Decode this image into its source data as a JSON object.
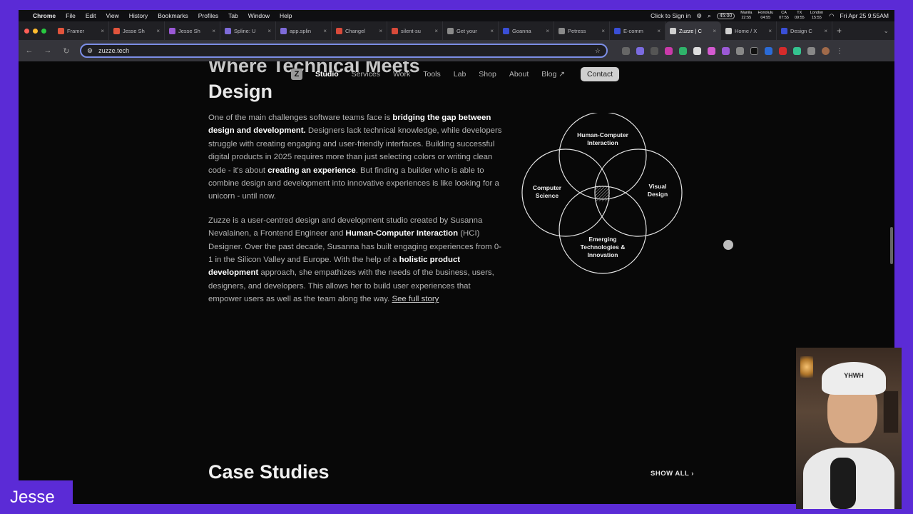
{
  "menubar": {
    "app": "Chrome",
    "items": [
      "File",
      "Edit",
      "View",
      "History",
      "Bookmarks",
      "Profiles",
      "Tab",
      "Window",
      "Help"
    ],
    "sign_in": "Click to Sign in",
    "timer": "45:00",
    "clocks": [
      {
        "city": "Manila",
        "time": "22:55"
      },
      {
        "city": "Honolulu",
        "time": "04:55"
      },
      {
        "city": "CA",
        "time": "07:55"
      },
      {
        "city": "TX",
        "time": "09:55"
      },
      {
        "city": "London",
        "time": "15:55"
      }
    ],
    "datetime": "Fri Apr 25  9:55AM"
  },
  "tabs": [
    {
      "label": "Framer",
      "color": "#e2543c"
    },
    {
      "label": "Jesse Sh",
      "color": "#e2543c"
    },
    {
      "label": "Jesse Sh",
      "color": "#9b59d6"
    },
    {
      "label": "Spline: U",
      "color": "#7e6bd9"
    },
    {
      "label": "app.splin",
      "color": "#7e6bd9"
    },
    {
      "label": "Changel",
      "color": "#d84a3a"
    },
    {
      "label": "silent-su",
      "color": "#d84a3a"
    },
    {
      "label": "Get your",
      "color": "#8a8a8a"
    },
    {
      "label": "Goanna",
      "color": "#3a4fd6"
    },
    {
      "label": "Petress",
      "color": "#8a8a8a"
    },
    {
      "label": "E-comm",
      "color": "#3a4fd6"
    },
    {
      "label": "Zuzze | C",
      "color": "#cfcfcf"
    },
    {
      "label": "Home / X",
      "color": "#cfcfcf"
    },
    {
      "label": "Design C",
      "color": "#3a4fd6"
    }
  ],
  "active_tab": 11,
  "address": {
    "url": "zuzze.tech"
  },
  "page": {
    "heading_top": "Where Technical Meets",
    "heading": "Design",
    "nav": {
      "items": [
        "Studio",
        "Services",
        "Work",
        "Tools",
        "Lab",
        "Shop",
        "About",
        "Blog ↗"
      ],
      "contact": "Contact"
    },
    "para1": {
      "t1": "One of the main challenges software teams face is ",
      "b1": "bridging the gap between design and development.",
      "t2": " Designers lack technical knowledge, while developers struggle with creating engaging and user-friendly interfaces. Building successful digital products in 2025 requires more than just selecting colors or writing clean code - it's about ",
      "b2": "creating an experience",
      "t3": ". But finding a builder who is able to combine design and development into innovative experiences is like looking for a unicorn - until now."
    },
    "para2": {
      "t1": "Zuzze is a user-centred design and development studio created by Susanna Nevalainen, a Frontend Engineer and ",
      "b1": "Human-Computer Interaction",
      "t2": " (HCI) Designer. Over the past decade, Susanna has built engaging experiences from 0-1 in the Silicon Valley and Europe. With the help of a ",
      "b2": "holistic product development",
      "t3": " approach, she empathizes with the needs of the business, users, designers, and developers. This allows her to build user experiences that empower users as well as the team along the way. ",
      "link": "See full story"
    },
    "venn": {
      "top": [
        "Human-Computer",
        "Interaction"
      ],
      "left": [
        "Computer",
        "Science"
      ],
      "right": [
        "Visual",
        "Design"
      ],
      "bottom": [
        "Emerging",
        "Technologies &",
        "Innovation"
      ]
    },
    "case_studies": "Case Studies",
    "show_all": "SHOW ALL  ›"
  },
  "webcam": {
    "cap_text": "YHWH"
  },
  "name_tag": "Jesse"
}
